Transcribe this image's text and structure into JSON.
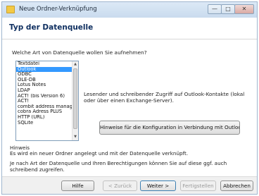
{
  "window": {
    "title": "Neue Ordner-Verknüpfung",
    "buttons": {
      "minimize": "—",
      "maximize": "□",
      "close": "✕"
    }
  },
  "page": {
    "title": "Typ der Datenquelle"
  },
  "question": "Welche Art von Datenquelle wollen Sie aufnehmen?",
  "datasource_list": {
    "items": [
      "Textdatei",
      "Outlook",
      "ODBC",
      "OLE-DB",
      "Lotus Notes",
      "LDAP",
      "ACT! (bis Version 6)",
      "ACT!",
      "combit address manag",
      "cobra Adress PLUS",
      "HTTP (URL)",
      "SQLite"
    ],
    "selected_index": 1,
    "scroll_up": "▲",
    "scroll_down": "▼"
  },
  "description": "Lesender und schreibender Zugriff auf Outlook-Kontakte (lokal oder über einen Exchange-Server).",
  "hint_button": "Hinweise für die Konfiguration in Verbindung mit Outlook ...",
  "info": {
    "label": "Hinweis",
    "line1": "Es wird ein neuer Ordner angelegt und mit der Datenquelle verknüpft.",
    "line2": "Je nach Art der Datenquelle und Ihren Berechtigungen können Sie auf diese ggf. auch schreibend zugreifen."
  },
  "footer": {
    "help": "Hilfe",
    "back": "< Zurück",
    "next": "Weiter >",
    "finish": "Fertigstellen",
    "cancel": "Abbrechen"
  },
  "colors": {
    "selection": "#3399ff",
    "title_text": "#0f2f60"
  }
}
